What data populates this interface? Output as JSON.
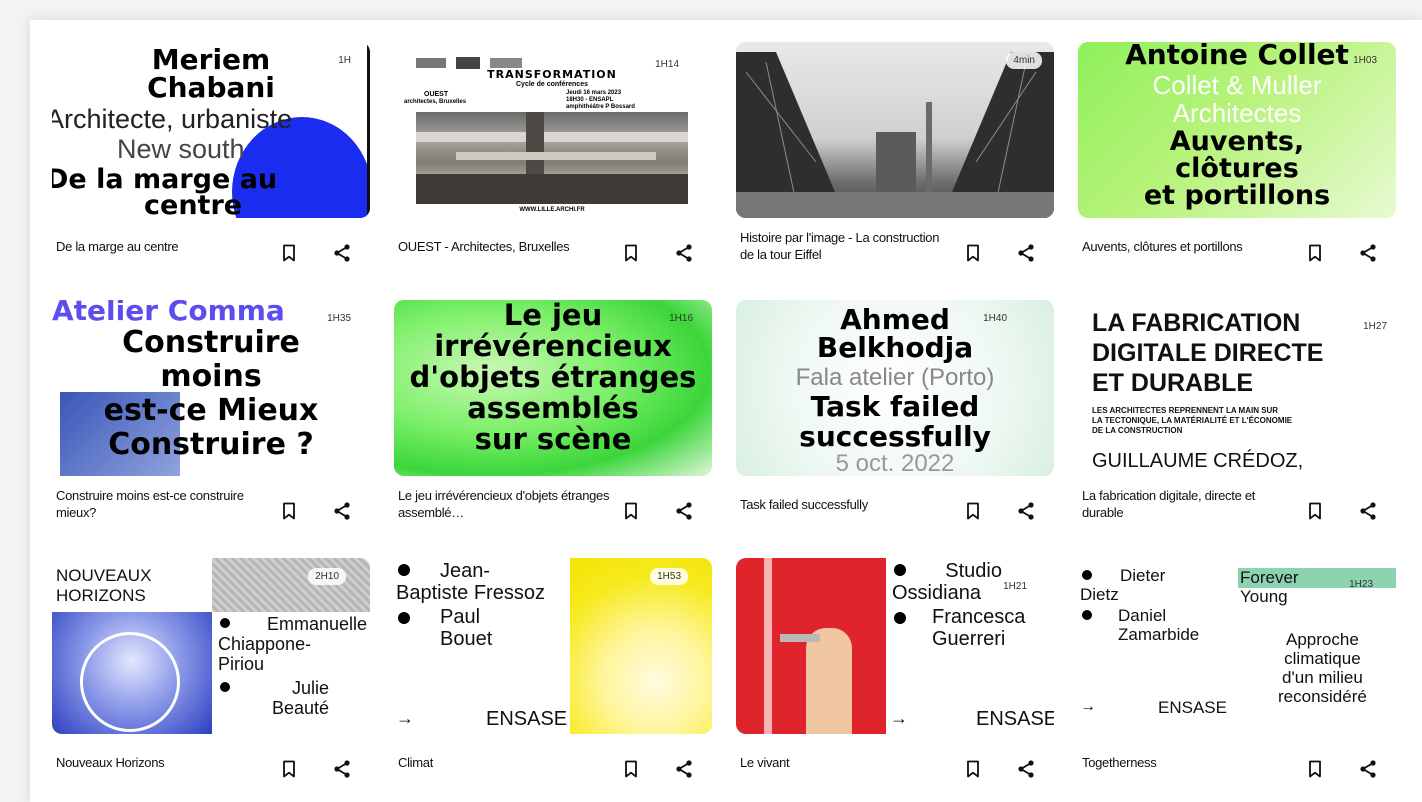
{
  "cards": [
    {
      "title": "De la marge au centre",
      "duration": "1H",
      "poster": [
        "Meriem",
        "Chabani",
        "Architecte, urbaniste",
        "New south",
        "De la marge au",
        "centre"
      ]
    },
    {
      "title": "OUEST - Architectes, Bruxelles",
      "duration": "1H14",
      "poster": [
        "TRANSFORMATION",
        "Cycle de conférences",
        "OUEST",
        "architectes, Bruxelles",
        "Jeudi 16 mars 2023",
        "18H30 - ENSAPL",
        "amphithéâtre P Bossard",
        "WWW.LILLE.ARCHI.FR"
      ]
    },
    {
      "title": "Histoire par l'image - La construction de la tour Eiffel",
      "duration": "4min",
      "poster": []
    },
    {
      "title": "Auvents, clôtures et portillons",
      "duration": "1H03",
      "poster": [
        "Antoine Collet",
        "Collet & Muller",
        "Architectes",
        "Auvents,",
        "clôtures",
        "et portillons"
      ]
    },
    {
      "title": "Construire moins est-ce construire mieux?",
      "duration": "1H35",
      "poster": [
        "Atelier Comma",
        "Construire",
        "moins",
        "est-ce Mieux",
        "Construire ?"
      ]
    },
    {
      "title": "Le jeu irrévérencieux d'objets étranges assemblé…",
      "duration": "1H16",
      "poster": [
        "Le jeu",
        "irrévérencieux",
        "d'objets étranges",
        "assemblés",
        "sur scène"
      ]
    },
    {
      "title": "Task failed successfully",
      "duration": "1H40",
      "poster": [
        "Ahmed",
        "Belkhodja",
        "Fala atelier (Porto)",
        "Task failed",
        "successfully",
        "5 oct. 2022"
      ]
    },
    {
      "title": "La fabrication digitale, directe et durable",
      "duration": "1H27",
      "poster": [
        "LA FABRICATION",
        "DIGITALE DIRECTE",
        "ET DURABLE",
        "LES ARCHITECTES REPRENNENT LA MAIN SUR",
        "LA TECTONIQUE, LA MATÉRIALITÉ ET L'ÉCONOMIE",
        "DE LA CONSTRUCTION",
        "GUILLAUME CRÉDOZ,"
      ]
    },
    {
      "title": "Nouveaux Horizons",
      "duration": "2H10",
      "poster": [
        "NOUVEAUX",
        "HORIZONS",
        "Emmanuelle",
        "Chiappone-",
        "Piriou",
        "Julie",
        "Beauté"
      ]
    },
    {
      "title": "Climat",
      "duration": "1H53",
      "poster": [
        "Jean-",
        "Baptiste Fressoz",
        "Paul",
        "Bouet",
        "→",
        "ENSASE"
      ]
    },
    {
      "title": "Le vivant",
      "duration": "1H21",
      "poster": [
        "Studio",
        "Ossidiana",
        "Francesca",
        "Guerreri",
        "→",
        "ENSASE"
      ]
    },
    {
      "title": "Togetherness",
      "duration": "1H23",
      "poster": [
        "Dieter",
        "Dietz",
        "Daniel",
        "Zamarbide",
        "→",
        "ENSASE",
        "Forever",
        "Young",
        "Approche",
        "climatique",
        "d'un milieu",
        "reconsidéré"
      ]
    }
  ],
  "icons": {
    "bookmark": "bookmark-icon",
    "share": "share-icon"
  }
}
